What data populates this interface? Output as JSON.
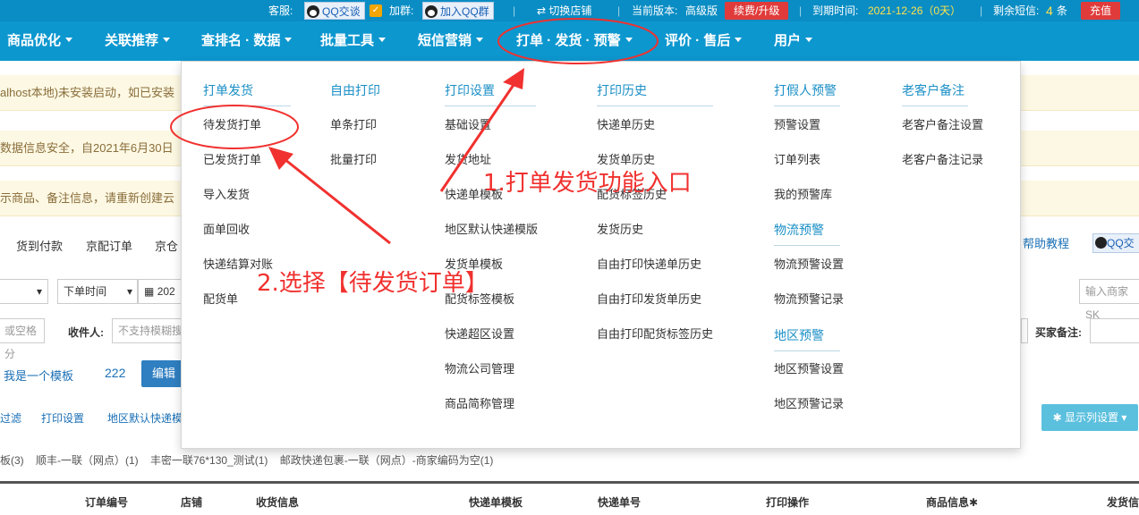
{
  "topbar": {
    "service_label": "客服:",
    "qq_chat": "QQ交谈",
    "join_group_label": "加群:",
    "join_qq_group": "加入QQ群",
    "switch_store": "切换店铺",
    "version_label": "当前版本:",
    "version_value": "高级版",
    "renew_button": "续费/升级",
    "expiry_label": "到期时间:",
    "expiry_value": "2021-12-26（0天）",
    "sms_label": "剩余短信:",
    "sms_count": "4",
    "sms_unit": "条",
    "recharge_button": "充值"
  },
  "nav": [
    {
      "label": "商品优化"
    },
    {
      "label": "关联推荐"
    },
    {
      "label": "查排名 · 数据"
    },
    {
      "label": "批量工具"
    },
    {
      "label": "短信营销"
    },
    {
      "label": "打单 · 发货 · 预警"
    },
    {
      "label": "评价 · 售后"
    },
    {
      "label": "用户"
    }
  ],
  "background": {
    "notice1": "alhost本地)未安装启动，如已安装",
    "notice2": "数据信息安全，自2021年6月30日",
    "notice3": "示商品、备注信息，请重新创建云",
    "tab1": "货到付款",
    "tab2": "京配订单",
    "tab3": "京仓",
    "help": "帮助教程",
    "qq": "QQ交",
    "order_time": "下单时间",
    "date_prefix": "202",
    "merchant_placeholder": "输入商家SK",
    "space_placeholder": "或空格分",
    "receiver_label": "收件人:",
    "receiver_placeholder": "不支持模糊搜",
    "buyer_note_label": "买家备注:",
    "template_text": "我是一个模板",
    "template_num": "222",
    "edit_button": "编辑",
    "filter_link": "过滤",
    "print_settings_link": "打印设置",
    "region_default_link": "地区默认快递模",
    "show_columns_button": "显示列设置",
    "template_list": "板(3)    顺丰-一联（网点）(1)    丰密一联76*130_测试(1)    邮政快递包裹-一联（网点）-商家编码为空(1)",
    "columns": [
      "订单编号",
      "店铺",
      "收货信息",
      "快递单模板",
      "快递单号",
      "打印操作",
      "商品信息",
      "发货信"
    ]
  },
  "dropdown": {
    "columns": [
      {
        "head": "打单发货",
        "items": [
          "待发货打单",
          "已发货打单",
          "导入发货",
          "面单回收",
          "快递结算对账",
          "配货单"
        ]
      },
      {
        "head": "自由打印",
        "items": [
          "单条打印",
          "批量打印"
        ]
      },
      {
        "head": "打印设置",
        "items": [
          "基础设置",
          "发货地址",
          "快递单模板",
          "地区默认快递模版",
          "发货单模板",
          "配货标签模板",
          "快递超区设置",
          "物流公司管理",
          "商品简称管理"
        ]
      },
      {
        "head": "打印历史",
        "items": [
          "快递单历史",
          "发货单历史",
          "配货标签历史",
          "发货历史",
          "自由打印快递单历史",
          "自由打印发货单历史",
          "自由打印配货标签历史"
        ]
      },
      {
        "head": "打假人预警",
        "items": [
          "预警设置",
          "订单列表",
          "我的预警库"
        ]
      },
      {
        "head": "物流预警",
        "items": [
          "物流预警设置",
          "物流预警记录"
        ]
      },
      {
        "head": "地区预警",
        "items": [
          "地区预警设置",
          "地区预警记录"
        ]
      },
      {
        "head": "老客户备注",
        "items": [
          "老客户备注设置",
          "老客户备注记录"
        ]
      }
    ]
  },
  "annotations": {
    "step1": "1.打单发货功能入口",
    "step2": "2.选择【待发货订单】"
  },
  "colors": {
    "nav_bg": "#0d97cf",
    "topbar_bg": "#0a8dc4",
    "menu_head": "#1b8fc6",
    "annotation_red": "#f0312f",
    "recharge_red": "#e03b3b"
  }
}
